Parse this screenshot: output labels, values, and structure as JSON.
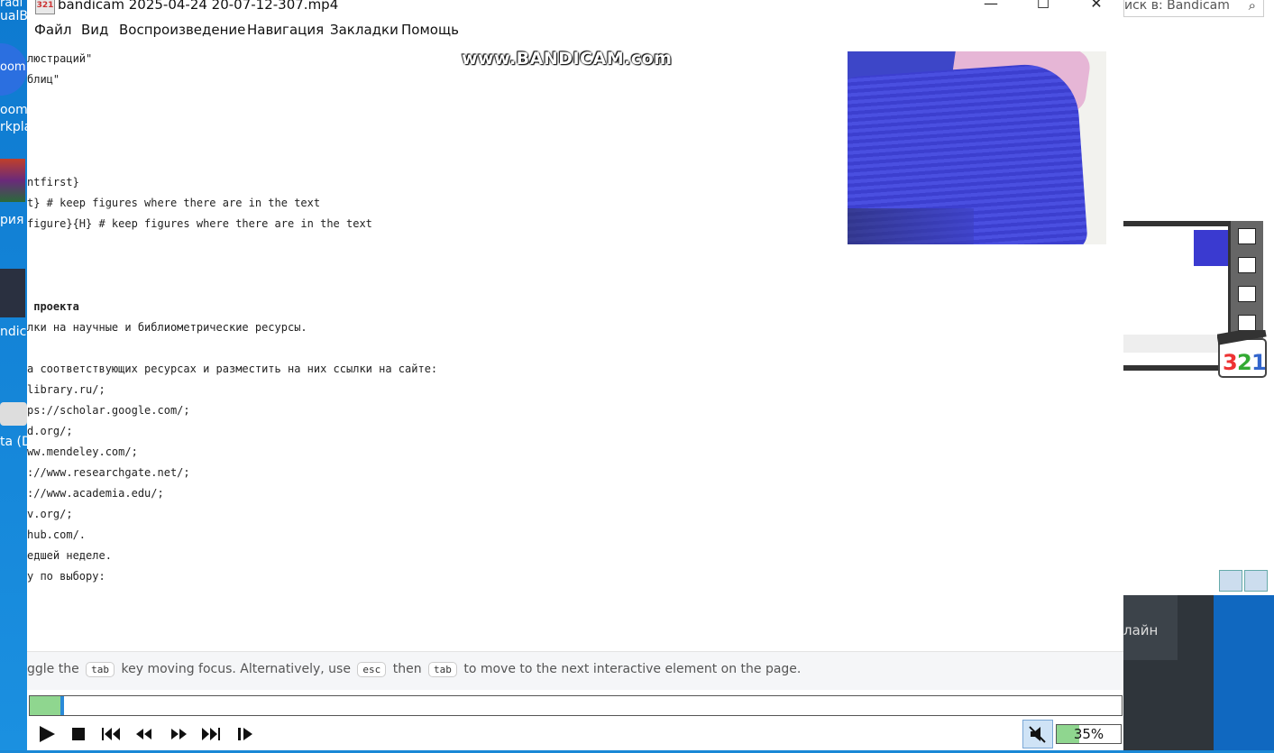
{
  "desktop": {
    "labels": [
      "ualB",
      "oom",
      "oom",
      "rkpla",
      "рия",
      "ndica",
      "ta (D"
    ]
  },
  "background_window": {
    "search_placeholder": "иск в: Bandicam",
    "taskbar_text": "лайн"
  },
  "window": {
    "title": "bandicam 2025-04-24 20-07-12-307.mp4",
    "app_icon_text": "321",
    "controls": {
      "minimize": "—",
      "maximize": "☐",
      "close": "✕"
    }
  },
  "menu": [
    "Файл",
    "Вид",
    "Воспроизведение",
    "Навигация",
    "Закладки",
    "Помощь"
  ],
  "watermark": "www.BANDICAM.com",
  "video_text": {
    "lines": [
      {
        "text": "люстраций\"",
        "bold": false
      },
      {
        "text": "блиц\"",
        "bold": false
      },
      {
        "text": "ntfirst}",
        "bold": false
      },
      {
        "text": "t} # keep figures where there are in the text",
        "bold": false
      },
      {
        "text": "figure}{H} # keep figures where there are in the text",
        "bold": false
      },
      {
        "text": " проекта",
        "bold": true
      },
      {
        "text": "лки на научные и библиометрические ресурсы.",
        "bold": false
      },
      {
        "text": "а соответствующих ресурсах и разместить на них ссылки на сайте:",
        "bold": false
      },
      {
        "text": "library.ru/;",
        "bold": false
      },
      {
        "text": "ps://scholar.google.com/;",
        "bold": false
      },
      {
        "text": "d.org/;",
        "bold": false
      },
      {
        "text": "ww.mendeley.com/;",
        "bold": false
      },
      {
        "text": "://www.researchgate.net/;",
        "bold": false
      },
      {
        "text": "://www.academia.edu/;",
        "bold": false
      },
      {
        "text": "v.org/;",
        "bold": false
      },
      {
        "text": "hub.com/.",
        "bold": false
      },
      {
        "text": "едшей неделе.",
        "bold": false
      },
      {
        "text": "у по выбору:",
        "bold": false
      }
    ]
  },
  "hint": {
    "prefix": "ggle the",
    "key1": "tab",
    "mid1": "key moving focus. Alternatively, use",
    "key2": "esc",
    "mid2": "then",
    "key3": "tab",
    "suffix": "to move to the next interactive element on the page."
  },
  "playback": {
    "progress_fraction": 0.028,
    "volume_percent": 35,
    "volume_label": "35%"
  },
  "control_icons": [
    "play-icon",
    "stop-icon",
    "previous-icon",
    "rewind-icon",
    "fast-forward-icon",
    "next-icon",
    "frame-step-icon"
  ]
}
